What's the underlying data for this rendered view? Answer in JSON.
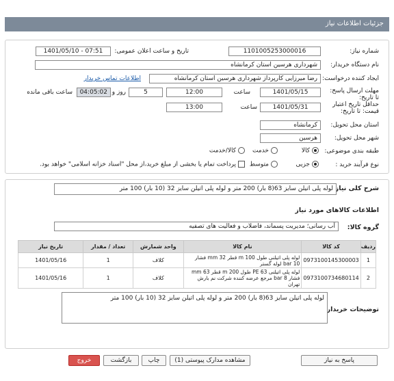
{
  "header": {
    "title": "جزئیات اطلاعات نیاز"
  },
  "form": {
    "need_number_label": "شماره نیاز:",
    "need_number": "1101005253000016",
    "announce_label": "تاریخ و ساعت اعلان عمومی:",
    "announce_value": "1401/05/10 - 07:51",
    "buyer_org_label": "نام دستگاه خریدار:",
    "buyer_org": "شهرداری هرسین استان کرمانشاه",
    "requester_label": "ایجاد کننده درخواست:",
    "requester": "رضا میرزایی کارپرداز شهرداری هرسین استان کرمانشاه",
    "contact_link": "اطلاعات تماس خریدار",
    "deadline_label": "مهلت ارسال پاسخ: تا تاریخ:",
    "deadline_date": "1401/05/15",
    "time_label": "ساعت",
    "deadline_time": "12:00",
    "days_value": "5",
    "days_label": "روز و",
    "remaining_time": "04:05:02",
    "remaining_label": "ساعت باقی مانده",
    "validity_label": "حداقل تاریخ اعتبار قیمت: تا تاریخ:",
    "validity_date": "1401/05/31",
    "validity_time_label": "ساعت",
    "validity_time": "13:00",
    "province_label": "استان محل تحویل:",
    "province": "کرمانشاه",
    "city_label": "شهر محل تحویل:",
    "city": "هرسین",
    "category_label": "طبقه بندی موضوعی:",
    "category_options": [
      "کالا",
      "خدمت",
      "کالا/خدمت"
    ],
    "category_selected": "کالا",
    "process_label": "نوع فرآیند خرید :",
    "process_options": [
      "جزیی",
      "متوسط"
    ],
    "process_selected": "جزیی",
    "payment_note": "پرداخت تمام یا بخشی از مبلغ خرید،از محل \"اسناد خزانه اسلامی\" خواهد بود."
  },
  "summary": {
    "label": "شرح کلی نیاز:",
    "value": "لوله پلی اتیلن سایز 63(8 بار) 200 متر  و لوله پلی اتیلن سایز 32 (10 بار) 100 متر"
  },
  "goods": {
    "section_title": "اطلاعات کالاهای مورد نیاز",
    "group_label": "گروه کالا:",
    "group_value": "آب رسانی؛ مدیریت پسماند، فاضلاب و فعالیت های تصفیه",
    "columns": [
      "ردیف",
      "کد کالا",
      "نام کالا",
      "واحد شمارش",
      "تعداد / مقدار",
      "تاریخ نیاز"
    ],
    "rows": [
      {
        "index": "1",
        "code": "0973100145300003",
        "name": "لوله پلی اتیلنی طول m 100 قطر mm 32 فشار bar 10 لوله گستر",
        "unit": "کلاف",
        "qty": "1",
        "date": "1401/05/16"
      },
      {
        "index": "2",
        "code": "0973100734680114",
        "name": "لوله پلی اتیلنی PE 63 طول m 200 قطر mm 63 فشار bar 8 مرجع عرضه کننده شرکت نم بارش تهران",
        "unit": "کلاف",
        "qty": "1",
        "date": "1401/05/16"
      }
    ]
  },
  "buyer_notes": {
    "label": "توضیحات خریدار:",
    "value": "لوله پلی اتیلن سایز 63(8 بار) 200 متر  و لوله پلی اتیلن سایز 32 (10 بار) 100 متر"
  },
  "buttons": {
    "respond": "پاسخ به نیاز",
    "attachments": "مشاهده مدارک پیوستی (1)",
    "print": "چاپ",
    "back": "بازگشت",
    "exit": "خروج"
  }
}
